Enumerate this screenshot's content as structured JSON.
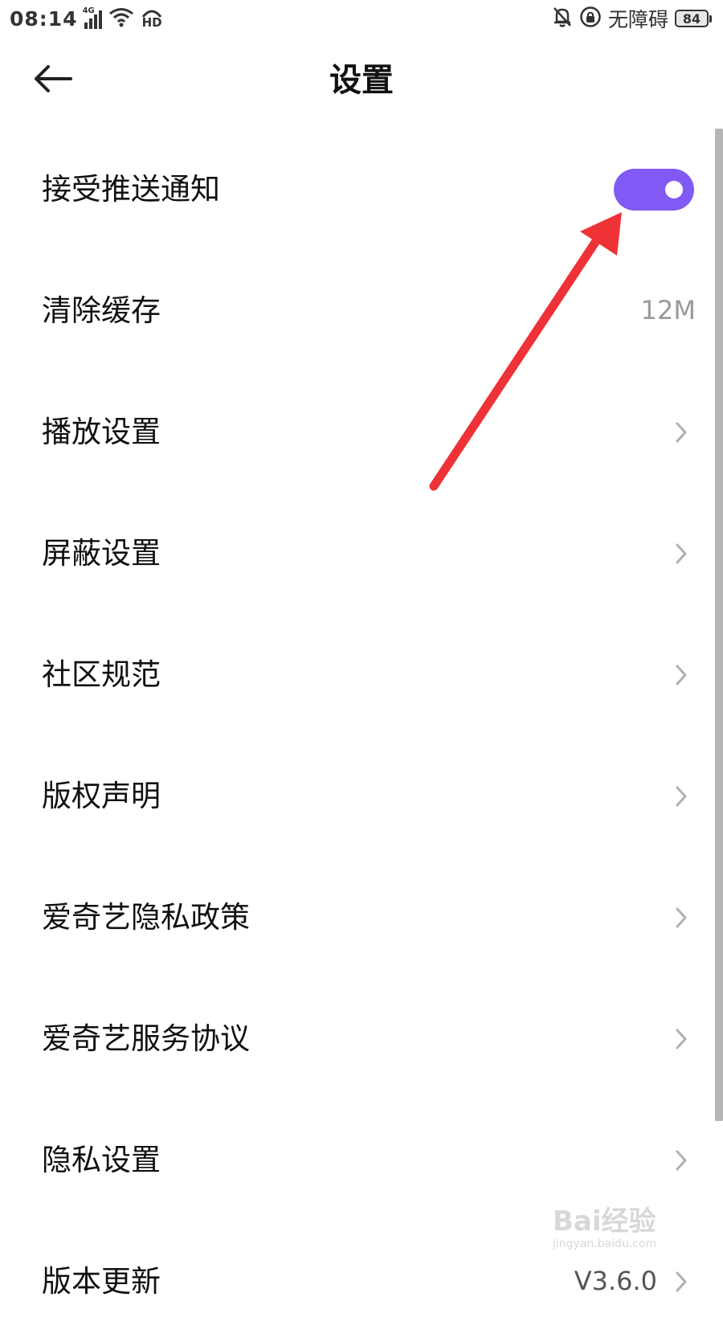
{
  "status_bar": {
    "time": "08:14",
    "network_badge": "4G",
    "hd_badge": "HD",
    "accessibility_text": "无障碍",
    "battery_level": "84"
  },
  "header": {
    "title": "设置"
  },
  "settings": {
    "items": [
      {
        "label": "接受推送通知",
        "control": "toggle",
        "toggle_on": true
      },
      {
        "label": "清除缓存",
        "value": "12M"
      },
      {
        "label": "播放设置",
        "icon": "chevron-right-icon"
      },
      {
        "label": "屏蔽设置",
        "icon": "chevron-right-icon"
      },
      {
        "label": "社区规范",
        "icon": "chevron-right-icon"
      },
      {
        "label": "版权声明",
        "icon": "chevron-right-icon"
      },
      {
        "label": "爱奇艺隐私政策",
        "icon": "chevron-right-icon"
      },
      {
        "label": "爱奇艺服务协议",
        "icon": "chevron-right-icon"
      },
      {
        "label": "隐私设置",
        "icon": "chevron-right-icon"
      },
      {
        "label": "版本更新",
        "value": "V3.6.0",
        "icon": "chevron-right-icon"
      }
    ]
  },
  "colors": {
    "toggle_on": "#8159f4",
    "annotation_arrow": "#ee3236",
    "secondary_text": "#999999"
  },
  "watermark": {
    "text": "Bai经验",
    "subtext": "jingyan.baidu.com"
  }
}
